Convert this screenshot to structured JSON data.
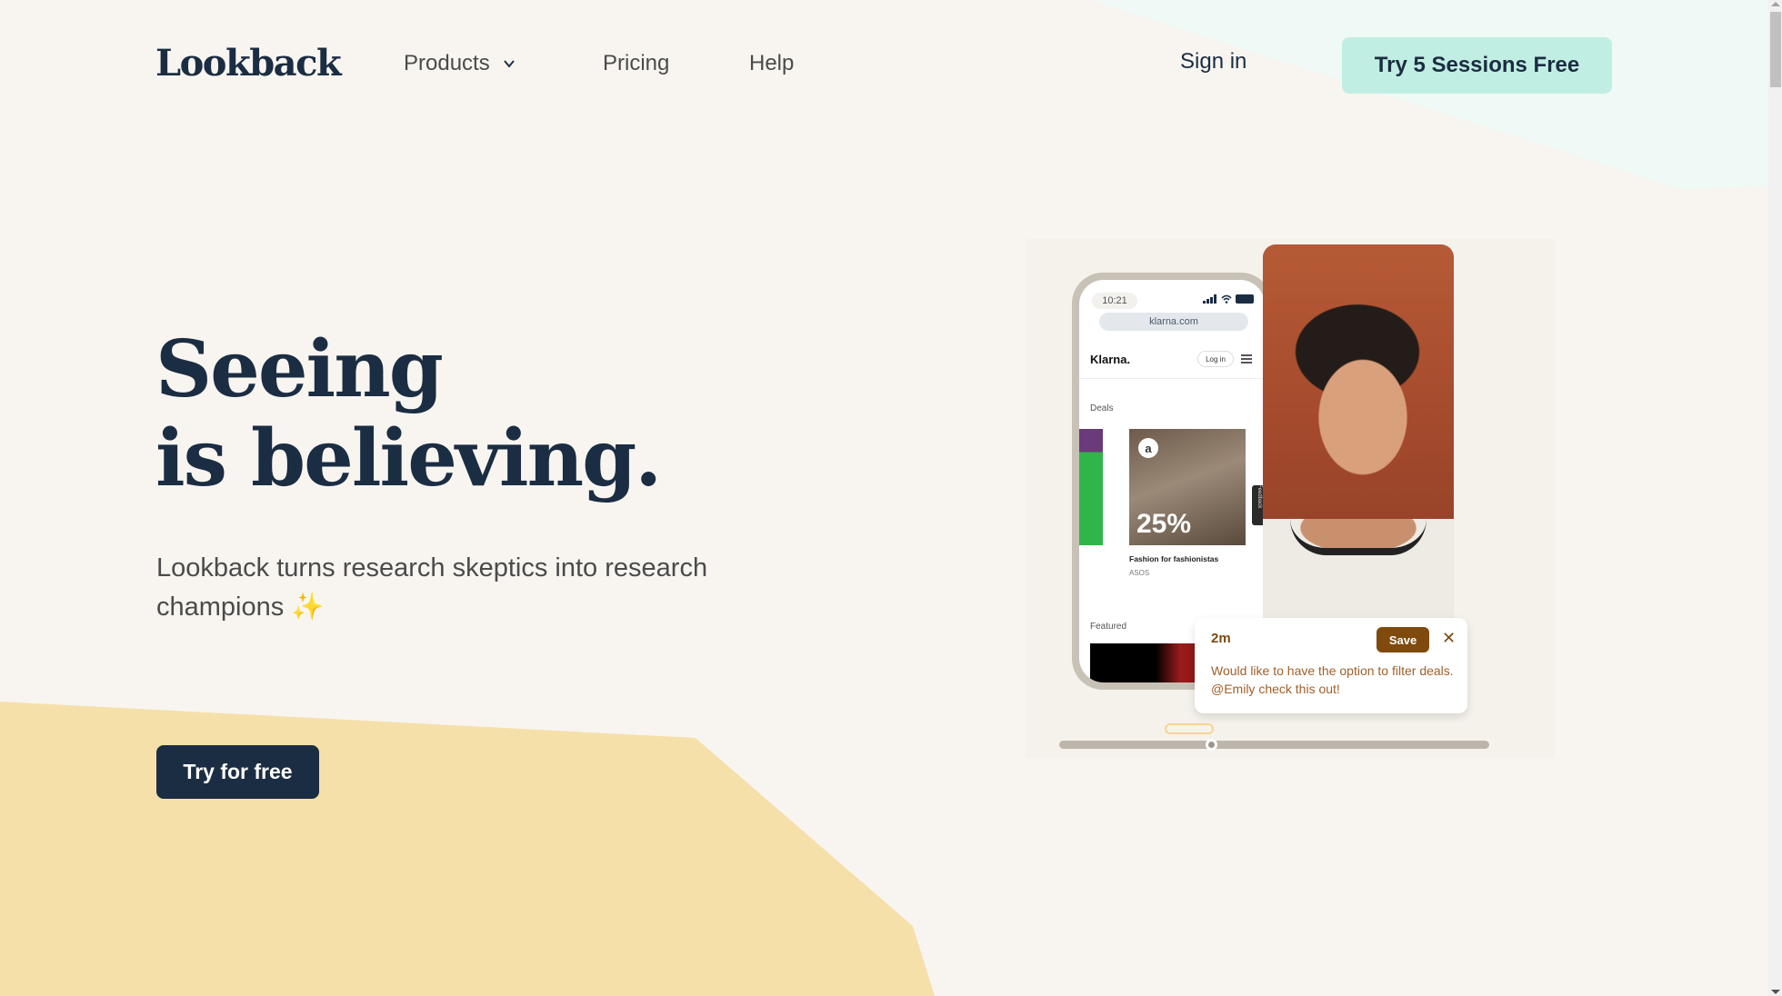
{
  "header": {
    "logo": "Lookback",
    "nav": [
      {
        "label": "Products",
        "has_dropdown": true
      },
      {
        "label": "Pricing"
      },
      {
        "label": "Help"
      }
    ],
    "signin_label": "Sign in",
    "cta_label": "Try 5 Sessions Free"
  },
  "hero": {
    "title_line1": "Seeing",
    "title_line2": "is believing.",
    "subtitle": "Lookback turns research skeptics into research champions",
    "subtitle_emoji": "✨",
    "cta_label": "Try for free"
  },
  "media": {
    "phone": {
      "time": "10:21",
      "url": "klarna.com",
      "site_logo": "Klarna.",
      "login_label": "Log in",
      "section_deals": "Deals",
      "deal_discount": "25%",
      "deal_logo": "a",
      "deal_title": "Fashion for fashionistas",
      "deal_brand": "ASOS",
      "feedback_tab": "Feedback",
      "section_featured": "Featured"
    },
    "comment": {
      "timestamp": "2m",
      "save_label": "Save",
      "close_glyph": "✕",
      "text": "Would like to have the option to filter deals. @Emily check this out!"
    },
    "timeline": {
      "progress_fraction": 0.355
    }
  },
  "colors": {
    "brand_navy": "#1b2d42",
    "mint": "#c1eee2",
    "mint_bg": "#eff9f5",
    "sand_bg": "#f8f5f1",
    "yellow_shape": "#f6e0aa",
    "comment_brown": "#7f4a0c"
  },
  "icons": {
    "products_chevron": "chevron-down-icon",
    "sparkle": "sparkles-icon",
    "close": "close-icon"
  }
}
